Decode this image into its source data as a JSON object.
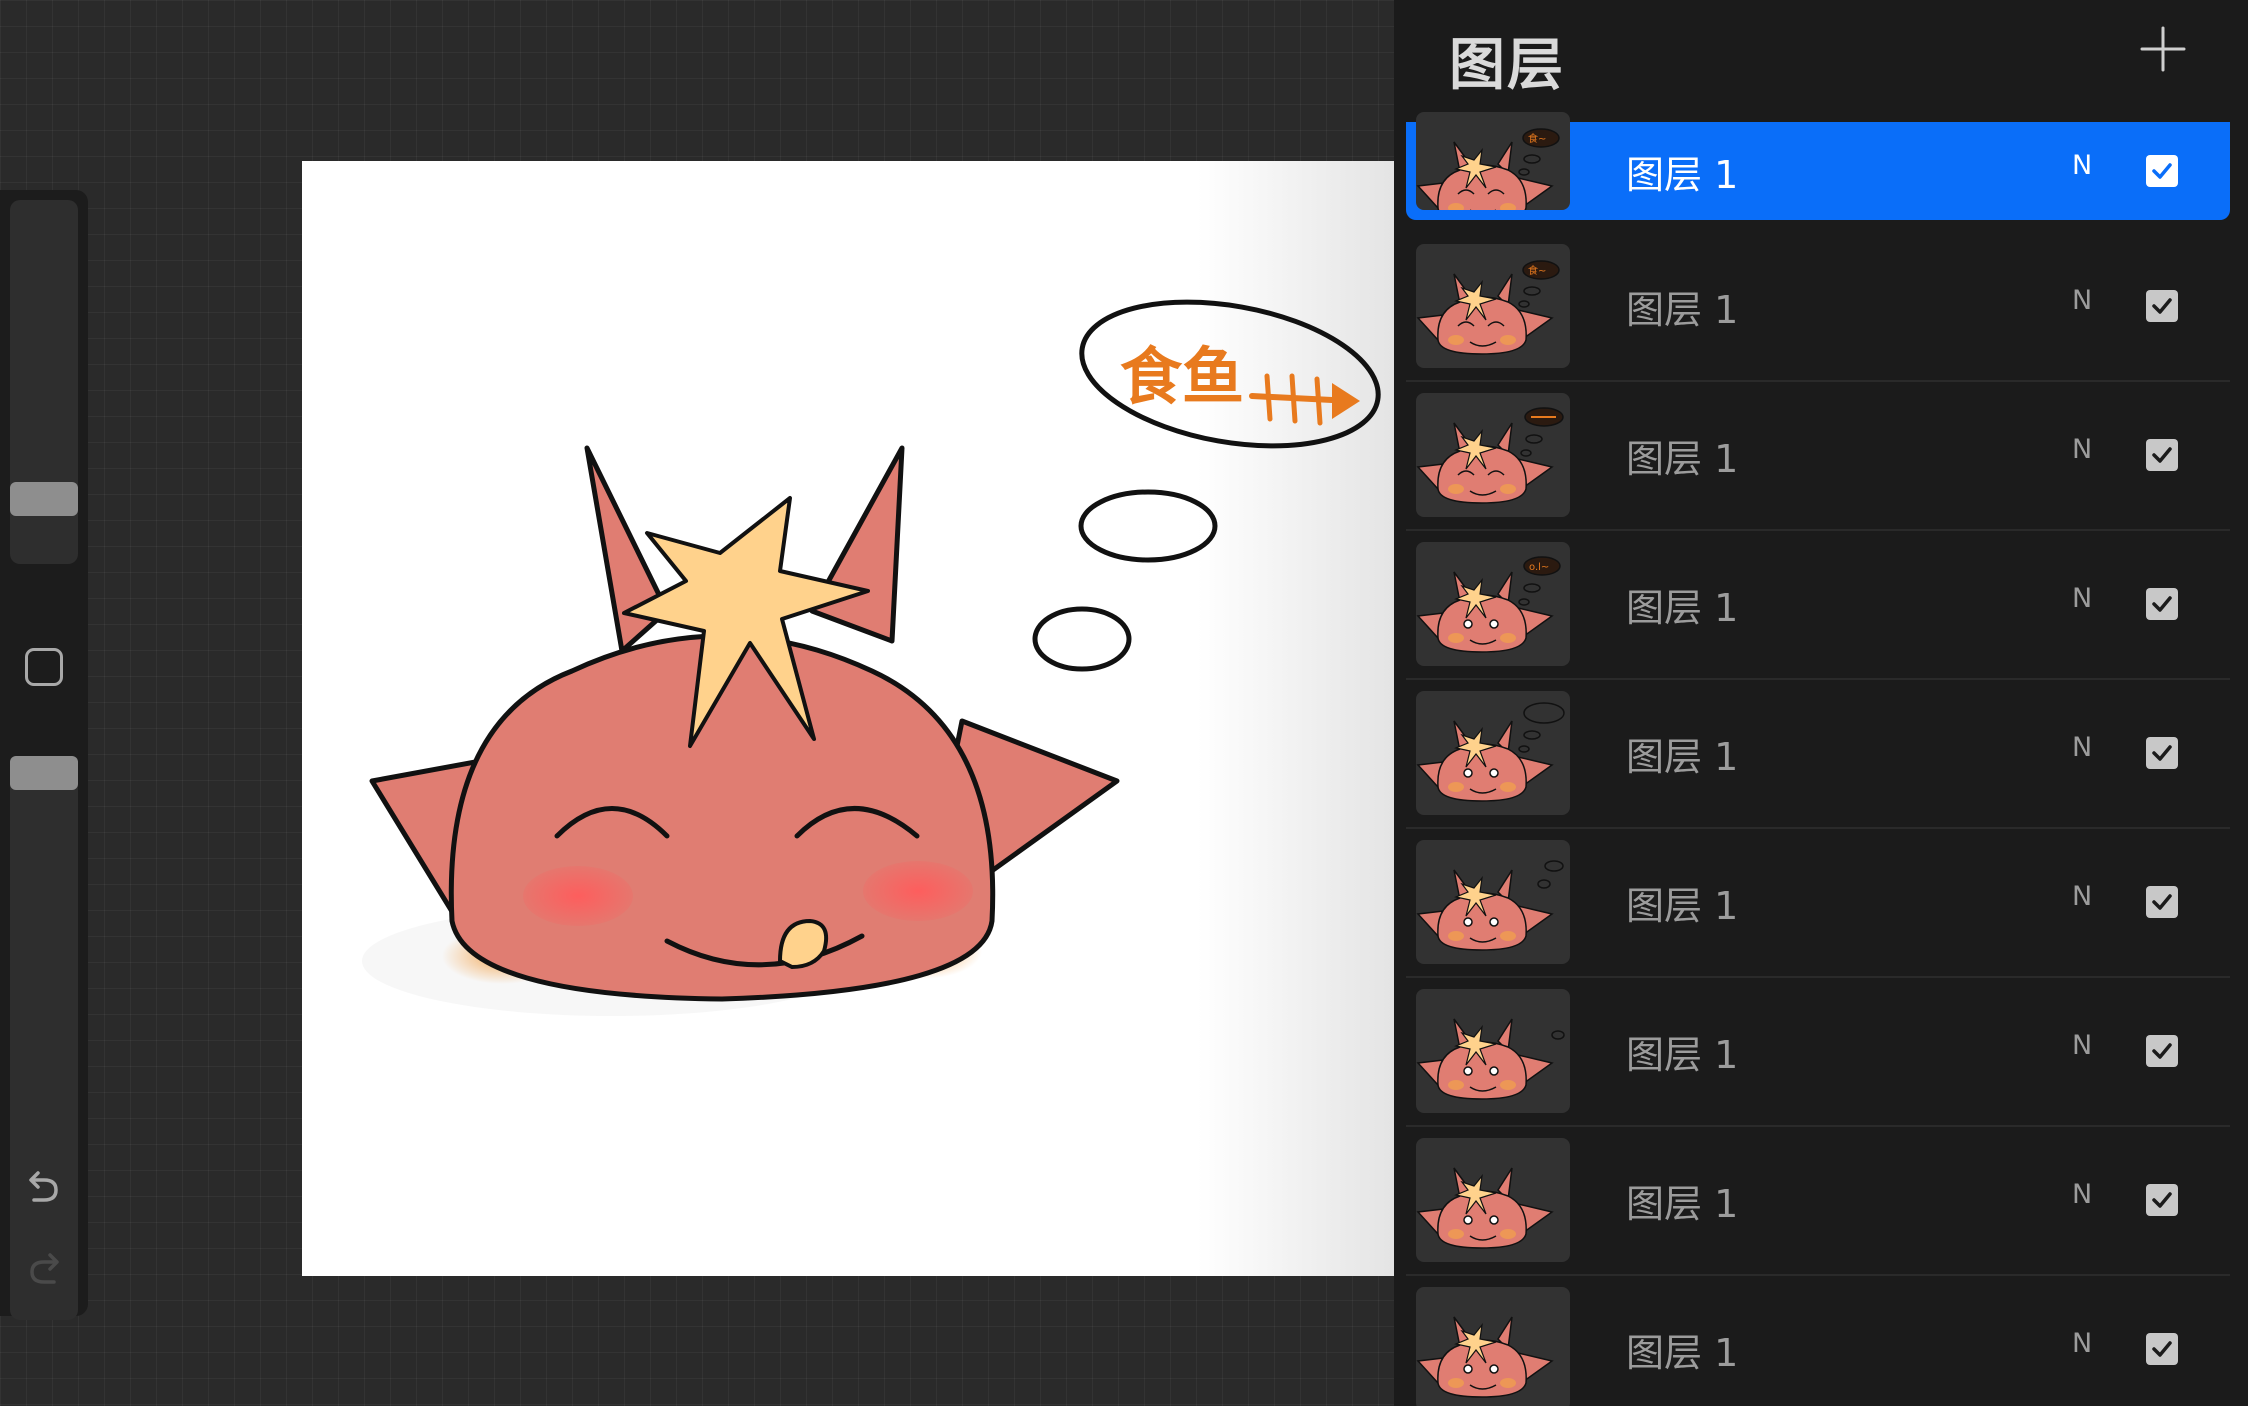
{
  "panel": {
    "title": "图层",
    "add_icon": "plus-icon",
    "layers": [
      {
        "name": "图层 1",
        "blend": "N",
        "visible": true,
        "active": true,
        "thought": "food-text"
      },
      {
        "name": "图层 1",
        "blend": "N",
        "visible": true,
        "active": false,
        "thought": "food-text"
      },
      {
        "name": "图层 1",
        "blend": "N",
        "visible": true,
        "active": false,
        "thought": "fishbone"
      },
      {
        "name": "图层 1",
        "blend": "N",
        "visible": true,
        "active": false,
        "thought": "scribble"
      },
      {
        "name": "图层 1",
        "blend": "N",
        "visible": true,
        "active": false,
        "thought": "empty-bubble"
      },
      {
        "name": "图层 1",
        "blend": "N",
        "visible": true,
        "active": false,
        "thought": "small-bubbles"
      },
      {
        "name": "图层 1",
        "blend": "N",
        "visible": true,
        "active": false,
        "thought": "one-bubble"
      },
      {
        "name": "图层 1",
        "blend": "N",
        "visible": true,
        "active": false,
        "thought": "none"
      },
      {
        "name": "图层 1",
        "blend": "N",
        "visible": true,
        "active": false,
        "thought": "none"
      }
    ]
  },
  "toolbar": {
    "brush_size_icon": "brush-size-slider",
    "modify_icon": "square-modify-icon",
    "opacity_icon": "opacity-slider",
    "undo_icon": "undo-icon",
    "redo_icon": "redo-icon"
  },
  "canvas": {
    "thought_text": "食鱼"
  },
  "colors": {
    "accent": "#0a6ef9",
    "creature": "#e07d72",
    "star": "#ffd28c",
    "blush": "#ff6464",
    "orange": "#e87a1e"
  }
}
